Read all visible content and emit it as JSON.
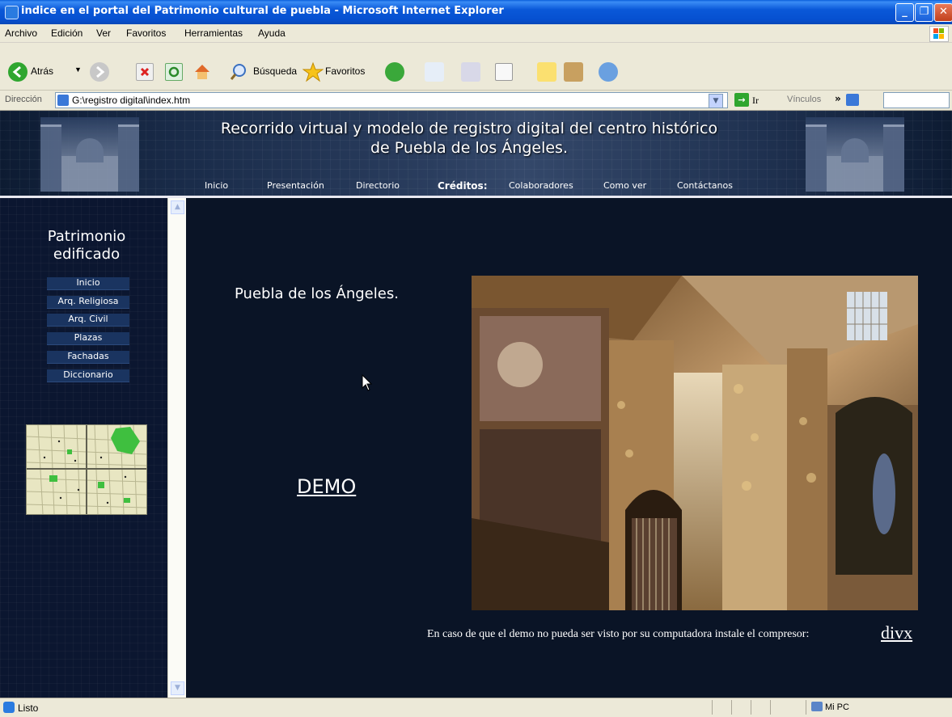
{
  "window": {
    "title": "indice en el portal del Patrimonio cultural de puebla - Microsoft Internet Explorer",
    "min_label": "_",
    "max_label": "❐",
    "close_label": "✕"
  },
  "menu": [
    "Archivo",
    "Edición",
    "Ver",
    "Favoritos",
    "Herramientas",
    "Ayuda"
  ],
  "toolbar": {
    "back_label": "Atrás",
    "search_label": "Búsqueda",
    "favorites_label": "Favoritos"
  },
  "address": {
    "label": "Dirección",
    "value": "G:\\registro digital\\index.htm",
    "go_label": "Ir",
    "links_label": "Vínculos"
  },
  "site": {
    "title_line1": "Recorrido virtual y modelo de registro digital del centro histórico",
    "title_line2": "de Puebla de los Ángeles.",
    "nav": [
      "Inicio",
      "Presentación",
      "Directorio",
      "Créditos:",
      "Colaboradores",
      "Como ver",
      "Contáctanos"
    ]
  },
  "sidebar": {
    "heading_line1": "Patrimonio",
    "heading_line2": "edificado",
    "items": [
      "Inicio",
      "Arq. Religiosa",
      "Arq. Civil",
      "Plazas",
      "Fachadas",
      "Diccionario"
    ]
  },
  "main": {
    "heading": "Puebla de los Ángeles.",
    "demo_link": "DEMO",
    "install_note": "En caso de que el demo no pueda ser visto por su computadora instale el compresor:",
    "divx_link": "divx"
  },
  "status": {
    "text": "Listo",
    "zone": "Mi PC"
  },
  "colors": {
    "page_bg": "#0a1426",
    "titlebar": "#0a58d8",
    "chrome": "#ece9d8"
  }
}
